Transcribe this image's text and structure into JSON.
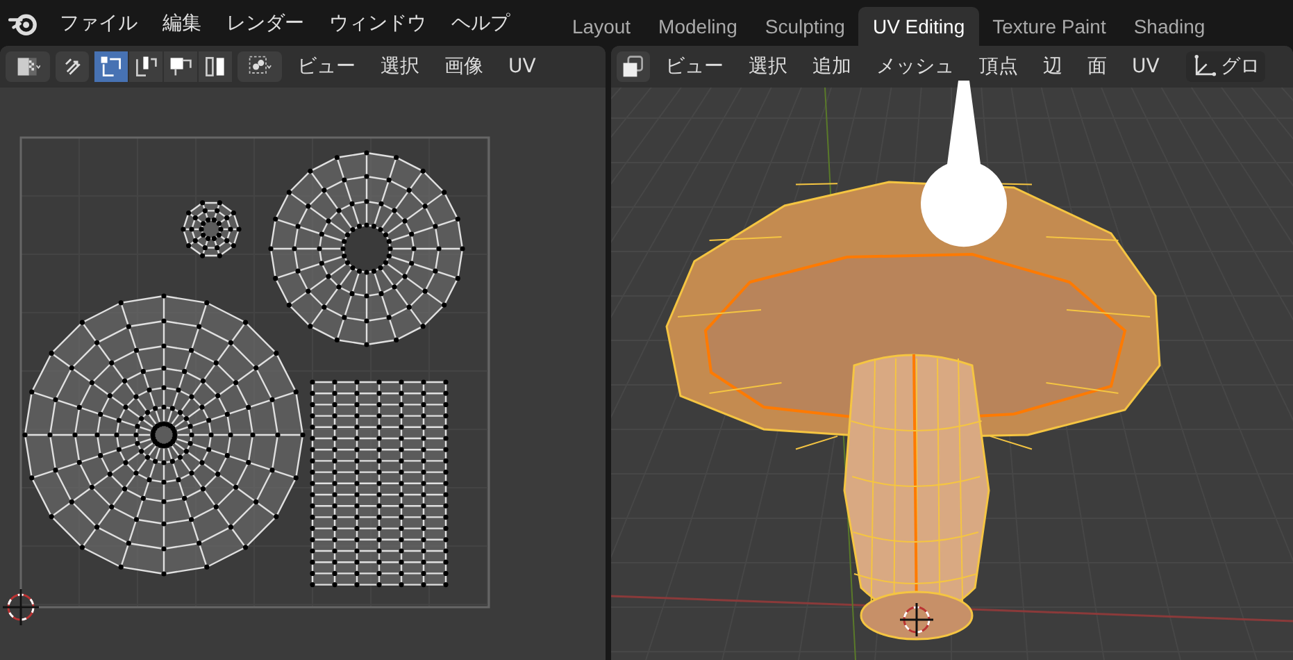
{
  "top_bar": {
    "menus": [
      "ファイル",
      "編集",
      "レンダー",
      "ウィンドウ",
      "ヘルプ"
    ],
    "workspace_tabs": [
      {
        "label": "Layout",
        "selected": false
      },
      {
        "label": "Modeling",
        "selected": false
      },
      {
        "label": "Sculpting",
        "selected": false
      },
      {
        "label": "UV Editing",
        "selected": true
      },
      {
        "label": "Texture Paint",
        "selected": false
      },
      {
        "label": "Shading",
        "selected": false
      }
    ]
  },
  "uv_editor": {
    "sync_selection": {
      "on": false
    },
    "select_modes": [
      {
        "selected": true
      },
      {
        "selected": false
      },
      {
        "selected": false
      },
      {
        "selected": false
      }
    ],
    "menus": [
      "ビュー",
      "選択",
      "画像",
      "UV"
    ]
  },
  "viewport": {
    "menus": [
      "ビュー",
      "選択",
      "追加",
      "メッシュ",
      "頂点",
      "辺",
      "面",
      "UV"
    ],
    "orientation": "グロ"
  }
}
